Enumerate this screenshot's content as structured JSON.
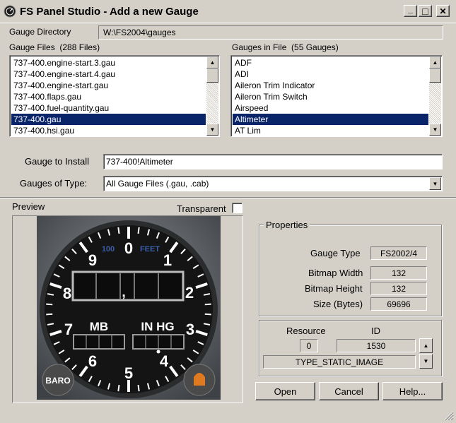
{
  "window": {
    "title": "FS Panel Studio - Add a new Gauge",
    "minimize_glyph": "_",
    "maximize_glyph": "□",
    "close_glyph": "✕"
  },
  "gauge_directory": {
    "label": "Gauge Directory",
    "value": "W:\\FS2004\\gauges"
  },
  "gauge_files": {
    "label": "Gauge Files",
    "count": "(288 Files)",
    "items": [
      "737-400.engine-start.3.gau",
      "737-400.engine-start.4.gau",
      "737-400.engine-start.gau",
      "737-400.flaps.gau",
      "737-400.fuel-quantity.gau",
      "737-400.gau",
      "737-400.hsi.gau"
    ],
    "selected_index": 5
  },
  "gauges_in_file": {
    "label": "Gauges in File",
    "count": "(55 Gauges)",
    "items": [
      "ADF",
      "ADI",
      "Aileron Trim Indicator",
      "Aileron Trim Switch",
      "Airspeed",
      "Altimeter",
      "AT Lim"
    ],
    "selected_index": 5
  },
  "gauge_to_install": {
    "label": "Gauge to Install",
    "value": "737-400!Altimeter"
  },
  "gauges_of_type": {
    "label": "Gauges of Type:",
    "value": "All Gauge Files (.gau, .cab)"
  },
  "preview": {
    "label": "Preview",
    "transparent_label": "Transparent",
    "gauge": {
      "dial_numbers": [
        "0",
        "1",
        "2",
        "3",
        "4",
        "5",
        "6",
        "7",
        "8",
        "9"
      ],
      "label_100": "100",
      "label_feet": "FEET",
      "label_mb": "MB",
      "label_inhg": "IN HG",
      "label_baro": "BARO",
      "comma": ","
    }
  },
  "properties": {
    "title": "Properties",
    "gauge_type_label": "Gauge Type",
    "gauge_type_value": "FS2002/4",
    "bitmap_width_label": "Bitmap Width",
    "bitmap_width_value": "132",
    "bitmap_height_label": "Bitmap Height",
    "bitmap_height_value": "132",
    "size_label": "Size (Bytes)",
    "size_value": "69696",
    "resource_label": "Resource",
    "id_label": "ID",
    "resource_value": "0",
    "id_value": "1530",
    "resource_type": "TYPE_STATIC_IMAGE"
  },
  "buttons": {
    "open": "Open",
    "cancel": "Cancel",
    "help": "Help..."
  },
  "colors": {
    "face": "#d4d0c8",
    "selection": "#0a246a",
    "gauge_dial": "#141414",
    "gauge_bezel": "#5a5e62",
    "baro_knob": "#e07a20"
  }
}
